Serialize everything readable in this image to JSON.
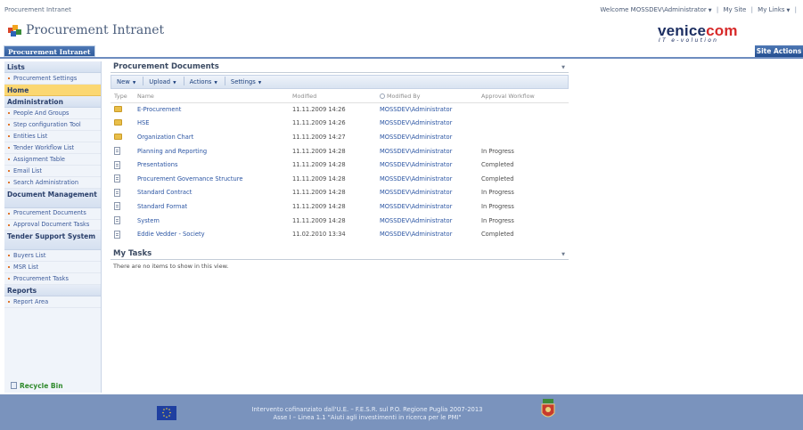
{
  "topbar": {
    "site_crumb": "Procurement Intranet",
    "welcome": "Welcome MOSSDEV\\Administrator",
    "my_site": "My Site",
    "my_links": "My Links"
  },
  "header": {
    "site_title": "Procurement Intranet",
    "tab_label": "Procurement Intranet",
    "brand_name_main": "venice",
    "brand_name_accent": "com",
    "brand_tagline": "IT e-volution",
    "site_actions": "Site Actions"
  },
  "sidebar": {
    "lists_heading": "Lists",
    "lists_items": [
      "Procurement Settings"
    ],
    "home_label": "Home",
    "admin_heading": "Administration",
    "admin_items": [
      "People And Groups",
      "Step configuration Tool",
      "Entities List",
      "Tender Workflow List",
      "Assignment Table",
      "Email List",
      "Search Administration"
    ],
    "docmgmt_heading": "Document Management",
    "docmgmt_items": [
      "Procurement Documents",
      "Approval Document Tasks"
    ],
    "tender_heading": "Tender Support System",
    "tender_items": [
      "Buyers List",
      "MSR List",
      "Procurement Tasks"
    ],
    "reports_heading": "Reports",
    "reports_items": [
      "Report Area"
    ],
    "recycle_bin": "Recycle Bin"
  },
  "documents": {
    "title": "Procurement Documents",
    "toolbar": {
      "new": "New",
      "upload": "Upload",
      "actions": "Actions",
      "settings": "Settings"
    },
    "columns": [
      "Type",
      "Name",
      "Modified",
      "Modified By",
      "Approval Workflow"
    ],
    "rows": [
      {
        "type": "folder",
        "name": "E-Procurement",
        "modified": "11.11.2009 14:26",
        "modified_by": "MOSSDEV\\Administrator",
        "workflow": ""
      },
      {
        "type": "folder",
        "name": "HSE",
        "modified": "11.11.2009 14:26",
        "modified_by": "MOSSDEV\\Administrator",
        "workflow": ""
      },
      {
        "type": "folder",
        "name": "Organization Chart",
        "modified": "11.11.2009 14:27",
        "modified_by": "MOSSDEV\\Administrator",
        "workflow": ""
      },
      {
        "type": "document",
        "name": "Planning and Reporting",
        "modified": "11.11.2009 14:28",
        "modified_by": "MOSSDEV\\Administrator",
        "workflow": "In Progress"
      },
      {
        "type": "document",
        "name": "Presentations",
        "modified": "11.11.2009 14:28",
        "modified_by": "MOSSDEV\\Administrator",
        "workflow": "Completed"
      },
      {
        "type": "document",
        "name": "Procurement Governance Structure",
        "modified": "11.11.2009 14:28",
        "modified_by": "MOSSDEV\\Administrator",
        "workflow": "Completed"
      },
      {
        "type": "document",
        "name": "Standard Contract",
        "modified": "11.11.2009 14:28",
        "modified_by": "MOSSDEV\\Administrator",
        "workflow": "In Progress"
      },
      {
        "type": "document",
        "name": "Standard Format",
        "modified": "11.11.2009 14:28",
        "modified_by": "MOSSDEV\\Administrator",
        "workflow": "In Progress"
      },
      {
        "type": "document",
        "name": "System",
        "modified": "11.11.2009 14:28",
        "modified_by": "MOSSDEV\\Administrator",
        "workflow": "In Progress"
      },
      {
        "type": "document",
        "name": "Eddie Vedder - Society",
        "modified": "11.02.2010 13:34",
        "modified_by": "MOSSDEV\\Administrator",
        "workflow": "Completed"
      }
    ]
  },
  "tasks": {
    "title": "My Tasks",
    "empty_message": "There are no items to show in this view."
  },
  "footer": {
    "line1": "Intervento cofinanziato dall'U.E. – F.E.S.R. sul P.O. Regione Puglia 2007-2013",
    "line2": "Asse I – Linea 1.1 \"Aiuti agli investimenti in ricerca per le PMI\""
  },
  "colors": {
    "accent_blue": "#2f5b9c",
    "home_highlight": "#fbd772",
    "footer_bg": "#7a93bd",
    "link": "#2b55a3"
  }
}
